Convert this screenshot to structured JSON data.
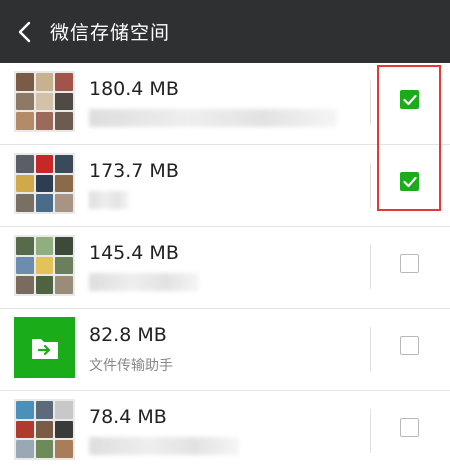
{
  "header": {
    "title": "微信存储空间",
    "back_icon": "chevron-left-icon"
  },
  "items": [
    {
      "size": "180.4 MB",
      "name": "",
      "checked": true,
      "thumb_colors": [
        "#7a5b45",
        "#c9b18f",
        "#a2534a",
        "#8c7a66",
        "#d1c2a8",
        "#4f4a44",
        "#b38b68",
        "#9c6a5a",
        "#6d5b50"
      ]
    },
    {
      "size": "173.7 MB",
      "name": "",
      "checked": true,
      "thumb_colors": [
        "#5a5f66",
        "#c62828",
        "#3b4a5a",
        "#d1a84a",
        "#2c3e50",
        "#8b6a4b",
        "#7a6f63",
        "#4a6b8a",
        "#a89484"
      ]
    },
    {
      "size": "145.4 MB",
      "name": "",
      "checked": false,
      "thumb_colors": [
        "#556b4a",
        "#8fb07e",
        "#3d4a3a",
        "#6c8db0",
        "#e2c35a",
        "#6a7f5c",
        "#7a6b5e",
        "#4f6340",
        "#9a8c78"
      ]
    },
    {
      "size": "82.8 MB",
      "name": "文件传输助手",
      "checked": false,
      "thumb_colors": []
    },
    {
      "size": "78.4 MB",
      "name": "",
      "checked": false,
      "thumb_colors": [
        "#4a90b8",
        "#5c6b7a",
        "#c8c8c8",
        "#b03a2e",
        "#7a5b45",
        "#3a3a3a",
        "#9aa8b4",
        "#6d8a5a",
        "#a77d5a"
      ]
    }
  ],
  "colors": {
    "titlebar_bg": "#2f3032",
    "accent_green": "#1aad19",
    "highlight_red": "#e53935"
  }
}
